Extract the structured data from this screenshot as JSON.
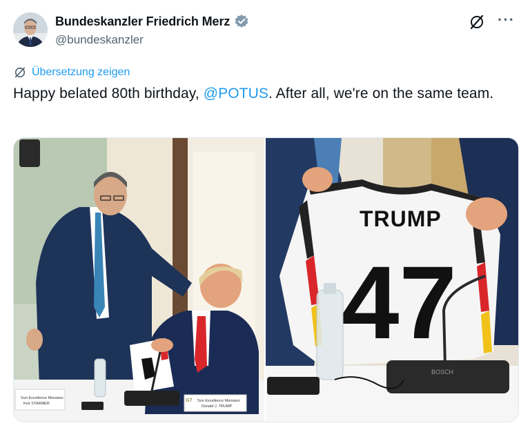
{
  "author": {
    "display_name": "Bundeskanzler Friedrich Merz",
    "handle": "@bundeskanzler",
    "verified": true,
    "avatar_icon": "person-in-suit-avatar"
  },
  "actions": {
    "grok_icon": "grok-icon",
    "more_label": "···"
  },
  "translate": {
    "label": "Übersetzung zeigen",
    "icon": "grok-icon"
  },
  "tweet": {
    "text_before": "Happy belated 80th birthday, ",
    "mention": "@POTUS",
    "text_after": ". After all, we're on the same team."
  },
  "media": {
    "left_photo": {
      "place_card_left": "Sun Excellence Monsieur\nKeir STARMER",
      "place_card_right": "Son Excellence Monsieur\nDonald J. TRUMP",
      "card_logo": "G7"
    },
    "right_photo": {
      "jersey_name": "TRUMP",
      "jersey_number": "47",
      "mic_brand": "BOSCH"
    }
  },
  "colors": {
    "link": "#1d9bf0",
    "text": "#0f1419",
    "secondary": "#536471"
  }
}
